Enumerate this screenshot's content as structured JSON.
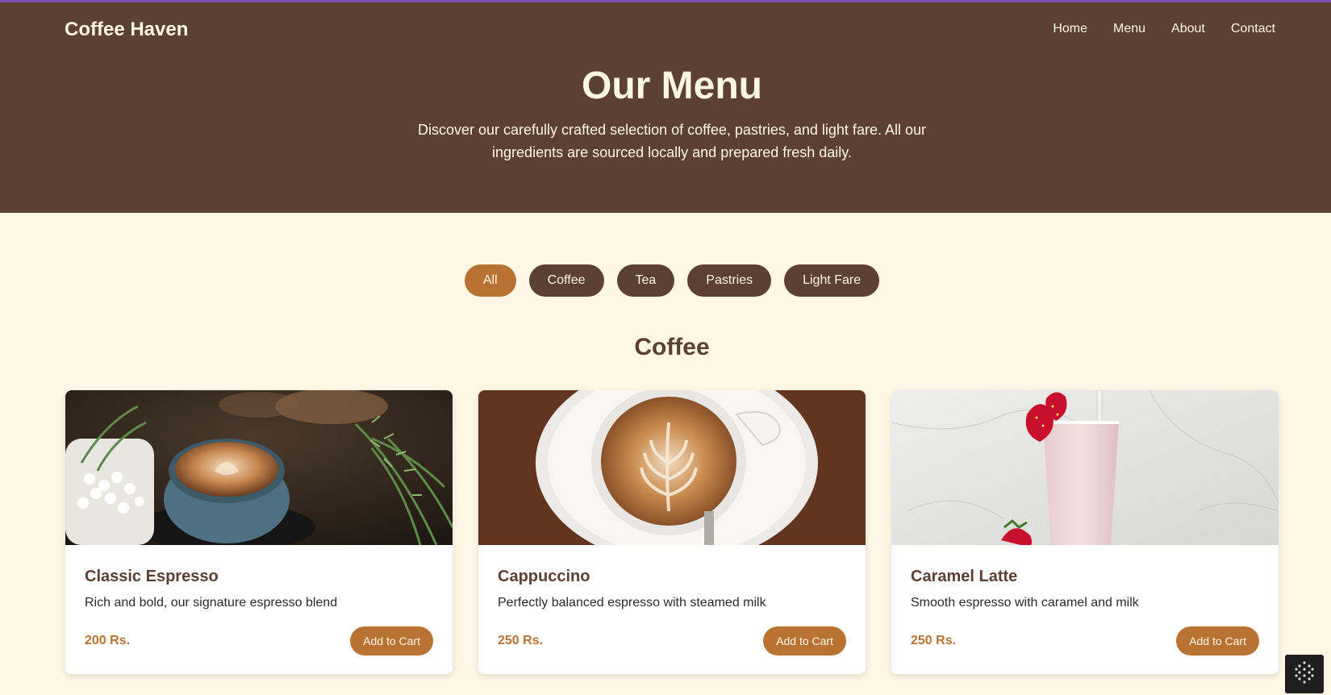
{
  "brand": "Coffee Haven",
  "nav": [
    "Home",
    "Menu",
    "About",
    "Contact"
  ],
  "hero": {
    "title": "Our Menu",
    "description": "Discover our carefully crafted selection of coffee, pastries, and light fare. All our ingredients are sourced locally and prepared fresh daily."
  },
  "filters": [
    "All",
    "Coffee",
    "Tea",
    "Pastries",
    "Light Fare"
  ],
  "active_filter": "All",
  "section_title": "Coffee",
  "items": [
    {
      "name": "Classic Espresso",
      "description": "Rich and bold, our signature espresso blend",
      "price": "200 Rs.",
      "button": "Add to Cart",
      "image": "espresso-cups-with-plants-photo"
    },
    {
      "name": "Cappuccino",
      "description": "Perfectly balanced espresso with steamed milk",
      "price": "250 Rs.",
      "button": "Add to Cart",
      "image": "latte-art-cup-top-view-photo"
    },
    {
      "name": "Caramel Latte",
      "description": "Smooth espresso with caramel and milk",
      "price": "250 Rs.",
      "button": "Add to Cart",
      "image": "pink-milkshake-with-strawberries-photo"
    }
  ],
  "colors": {
    "header_bg": "#5d4034",
    "page_bg": "#fff7e6",
    "accent": "#b87333"
  }
}
